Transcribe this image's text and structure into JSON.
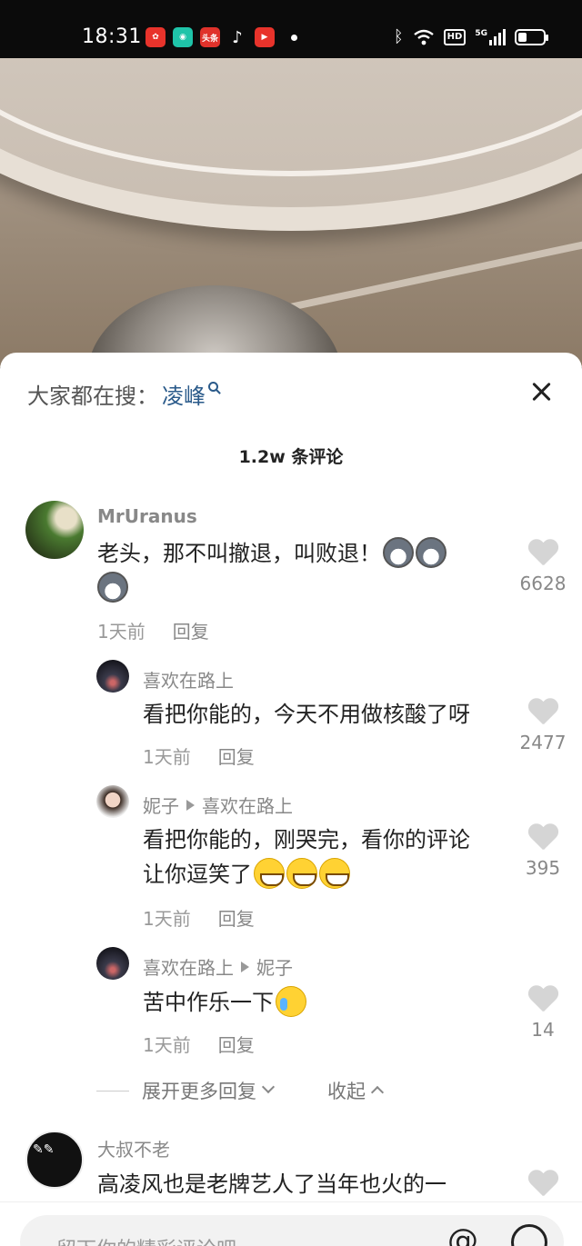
{
  "status_bar": {
    "time": "18:31",
    "apps": [
      {
        "icon": "app-icon-1",
        "label": "",
        "color": "#e8332b"
      },
      {
        "icon": "app-icon-2",
        "label": "",
        "color": "#1fc4a9"
      },
      {
        "icon": "toutiao-icon",
        "label": "头条",
        "color": "#e0322b"
      },
      {
        "icon": "tiktok-icon",
        "label": "",
        "color": "#000000"
      },
      {
        "icon": "video-app-icon",
        "label": "",
        "color": "#e8332b"
      }
    ],
    "hd": "HD",
    "signal": "5G"
  },
  "panel": {
    "search_prefix": "大家都在搜：",
    "search_keyword": "凌峰",
    "comment_count": "1.2w 条评论",
    "close_icon": "close-icon"
  },
  "comments": [
    {
      "user": "MrUranus",
      "text": "老头，那不叫撤退，叫败退！",
      "time": "1天前",
      "reply": "回复",
      "likes": "6628",
      "avatar_color": "#3d5a2a"
    }
  ],
  "replies": [
    {
      "user": "喜欢在路上",
      "reply_to": "",
      "text": "看把你能的，今天不用做核酸了呀",
      "time": "1天前",
      "reply": "回复",
      "likes": "2477",
      "avatar_color": "#2a2a35"
    },
    {
      "user": "妮子",
      "reply_to": "喜欢在路上",
      "text_line1": "看把你能的，刚哭完，看你的评论",
      "text_line2": "让你逗笑了",
      "time": "1天前",
      "reply": "回复",
      "likes": "395",
      "avatar_color": "#d8b8a8"
    },
    {
      "user": "喜欢在路上",
      "reply_to": "妮子",
      "text": "苦中作乐一下",
      "time": "1天前",
      "reply": "回复",
      "likes": "14",
      "avatar_color": "#2a2a35"
    }
  ],
  "expand": {
    "more_replies": "展开更多回复",
    "collapse": "收起"
  },
  "next_comment": {
    "user": "大叔不老",
    "text": "高凌风也是老牌艺人了当年也火的一",
    "avatar_color": "#111111"
  },
  "input": {
    "placeholder": "留下你的精彩评论吧",
    "at_icon": "@"
  }
}
